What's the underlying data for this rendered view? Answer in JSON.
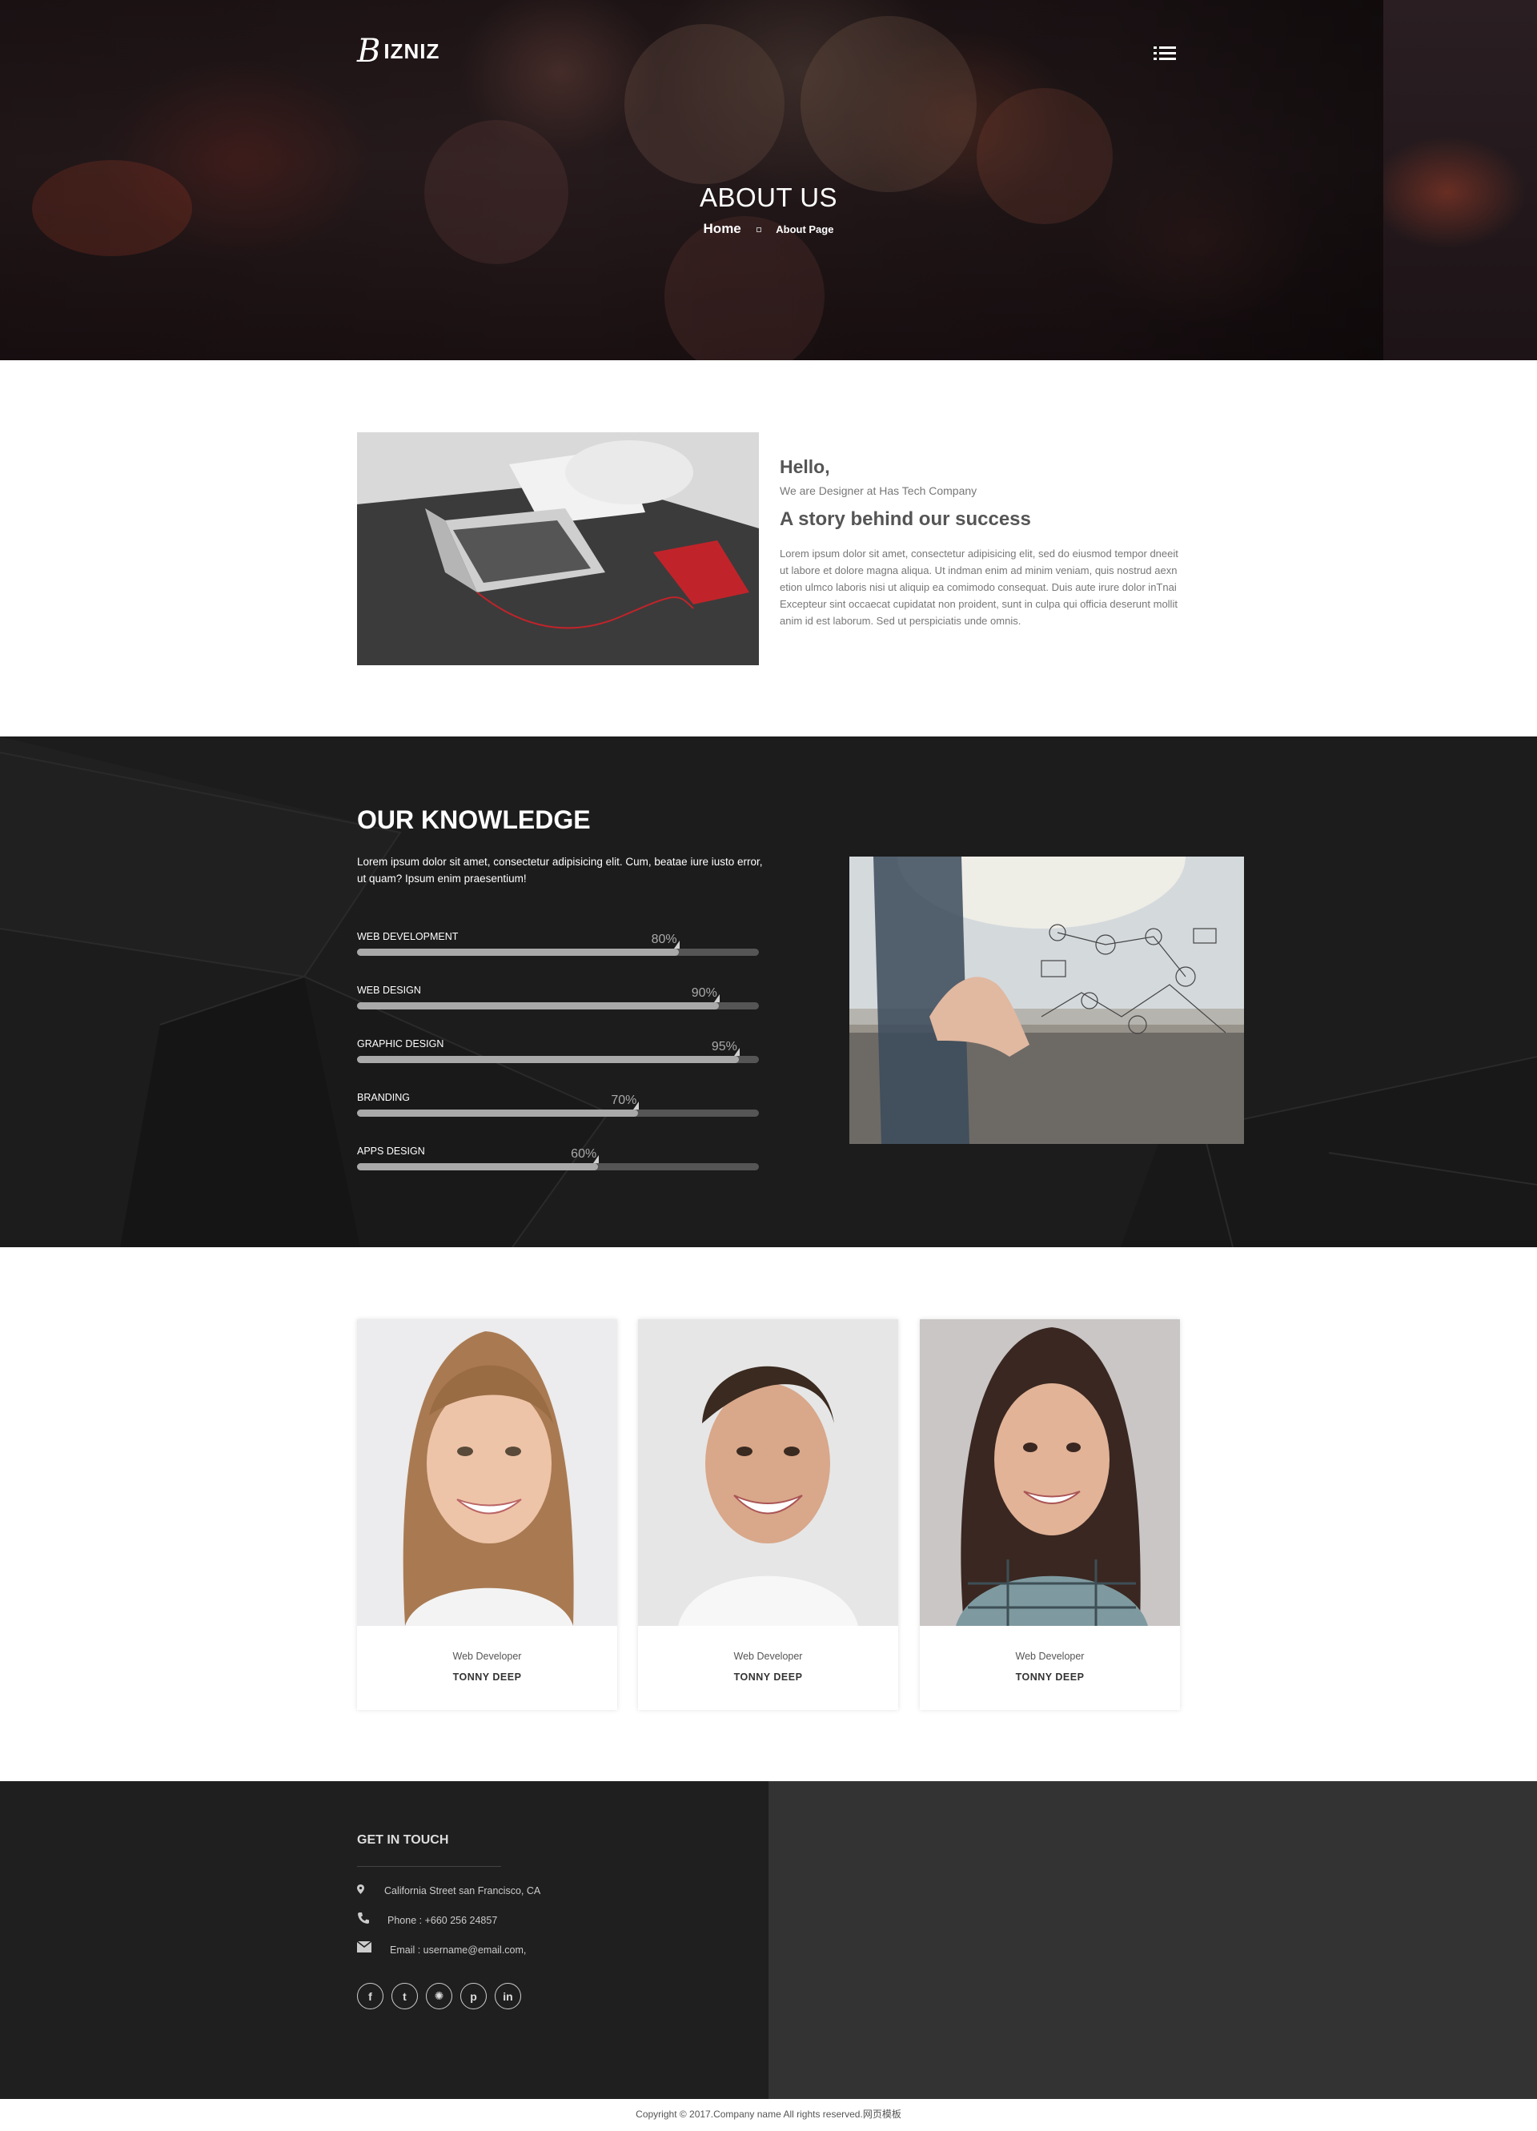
{
  "brand": {
    "logo_script": "B",
    "logo_text": "IZNIZ"
  },
  "hero": {
    "title": "ABOUT US",
    "breadcrumb_home": "Home",
    "breadcrumb_current": "About Page"
  },
  "about": {
    "hello": "Hello,",
    "subtitle": "We are Designer at Has Tech Company",
    "heading": "A story behind our success",
    "paragraph": "Lorem ipsum dolor sit amet, consectetur adipisicing elit, sed do eiusmod tempor dneeit ut labore et dolore magna aliqua. Ut indman enim ad minim veniam, quis nostrud aexn etion ulmco laboris nisi ut aliquip ea comimodo consequat. Duis aute irure dolor inTnai Excepteur sint occaecat cupidatat non proident, sunt in culpa qui officia deserunt mollit anim id est laborum. Sed ut perspiciatis unde omnis."
  },
  "knowledge": {
    "title": "OUR KNOWLEDGE",
    "description": "Lorem ipsum dolor sit amet, consectetur adipisicing elit. Cum, beatae iure iusto error, ut quam? Ipsum enim praesentium!",
    "skills": [
      {
        "label": "WEB DEVELOPMENT",
        "percent": 80,
        "percent_text": "80%"
      },
      {
        "label": "WEB DESIGN",
        "percent": 90,
        "percent_text": "90%"
      },
      {
        "label": "GRAPHIC DESIGN",
        "percent": 95,
        "percent_text": "95%"
      },
      {
        "label": "BRANDING",
        "percent": 70,
        "percent_text": "70%"
      },
      {
        "label": "APPS DESIGN",
        "percent": 60,
        "percent_text": "60%"
      }
    ]
  },
  "team": [
    {
      "role": "Web Developer",
      "name": "TONNY DEEP"
    },
    {
      "role": "Web Developer",
      "name": "TONNY DEEP"
    },
    {
      "role": "Web Developer",
      "name": "TONNY DEEP"
    }
  ],
  "footer": {
    "title": "GET IN TOUCH",
    "address": "California Street san Francisco, CA",
    "phone": "Phone : +660 256 24857",
    "email": "Email : username@email.com,",
    "socials": [
      "facebook-icon",
      "twitter-icon",
      "dribbble-icon",
      "pinterest-icon",
      "linkedin-icon"
    ],
    "social_glyphs": [
      "f",
      "t",
      "✺",
      "p",
      "in"
    ],
    "copyright": "Copyright © 2017.Company name All rights reserved.网页模板"
  },
  "colors": {
    "dark_section": "#1c1c1c",
    "footer_left": "#1f1f1f",
    "footer_right": "#333333",
    "bar_fill": "#a9a9a9",
    "bar_track": "#555555"
  }
}
